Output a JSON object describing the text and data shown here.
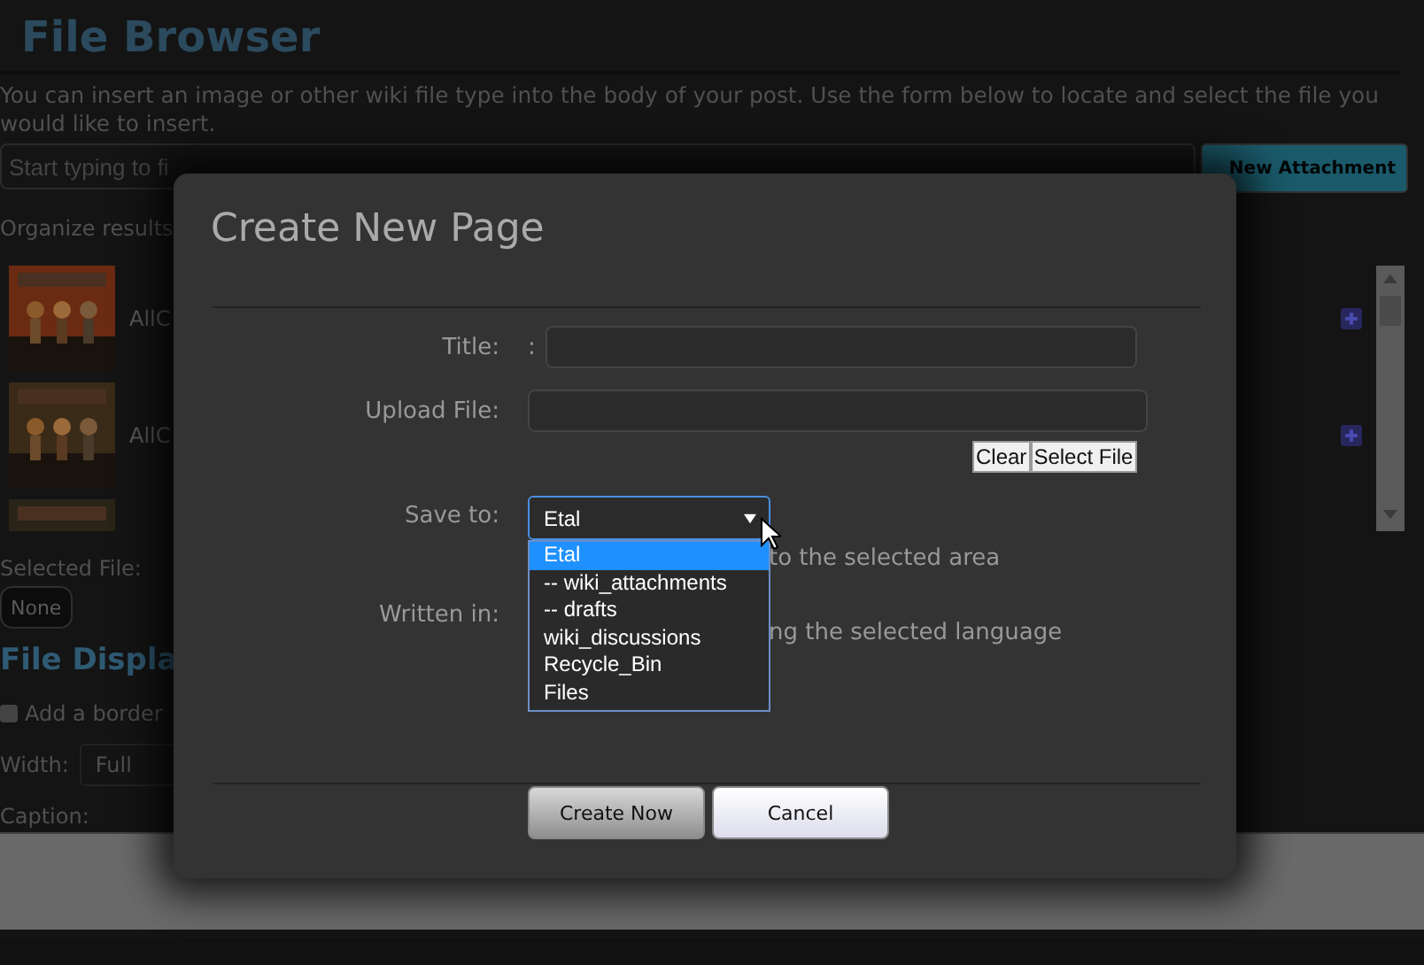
{
  "page": {
    "title": "File Browser",
    "description": "You can insert an image or other wiki file type into the body of your post. Use the form below to locate and select the file you would like to insert.",
    "filter": {
      "placeholder": "Start typing to fi"
    },
    "new_attachment_button": "New Attachment",
    "organize_label": "Organize results",
    "files": [
      {
        "kind": "picture",
        "name": "AllC"
      },
      {
        "kind": "picture",
        "name": "AllC"
      },
      {
        "kind": "picture"
      }
    ],
    "selected_file_label": "Selected File:",
    "selected_file_button": "None",
    "display_heading": "File Displa",
    "border_checkbox": {
      "label": "Add a border",
      "checked": false
    },
    "width_field": {
      "label": "Width:",
      "value": "Full"
    },
    "caption_label": "Caption:"
  },
  "dialog": {
    "title": "Create New Page",
    "title_field": {
      "label": "Title:",
      "prefix": ":"
    },
    "upload_field": {
      "label": "Upload File:"
    },
    "file_buttons": [
      "Clear",
      "Select File"
    ],
    "save_to": {
      "label": "Save to:",
      "value": "Etal",
      "hint": "to the selected area",
      "options": [
        {
          "label": "Etal",
          "selected": true
        },
        {
          "label": "-- wiki_attachments",
          "selected": false
        },
        {
          "label": "-- drafts",
          "selected": false
        },
        {
          "label": "wiki_discussions",
          "selected": false
        },
        {
          "label": "Recycle_Bin",
          "selected": false
        },
        {
          "label": "Files",
          "selected": false
        }
      ]
    },
    "written_in": {
      "label": "Written in:",
      "hint": "ng the selected language"
    },
    "buttons": [
      {
        "label": "Create Now",
        "kind": "primary"
      },
      {
        "label": "Cancel",
        "kind": "secondary"
      }
    ]
  }
}
